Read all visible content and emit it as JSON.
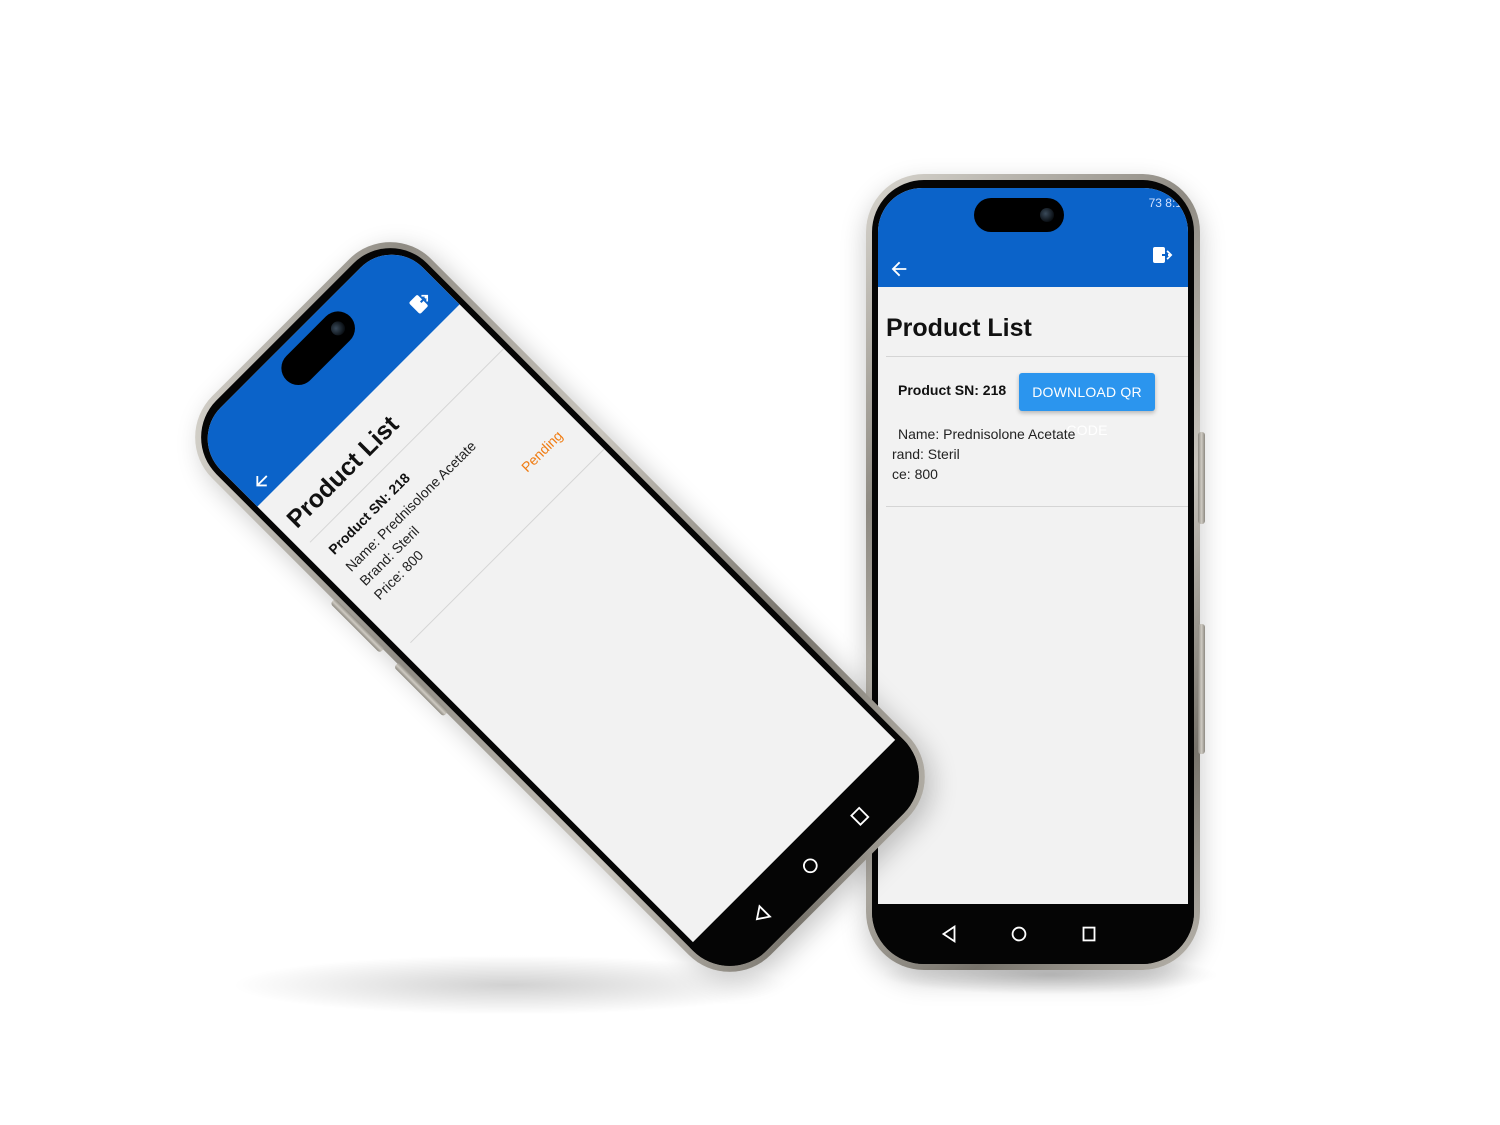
{
  "colors": {
    "appbar": "#0b63c9",
    "button": "#2b95ee",
    "pending": "#f07c12",
    "screen_bg": "#f2f2f2"
  },
  "left_phone": {
    "status_bar": "",
    "appbar": {
      "back_icon": "arrow-back-icon",
      "action_icon": "download-icon"
    },
    "page_title": "Product List",
    "product": {
      "sn": "Product SN: 218",
      "name": "Name: Prednisolone Acetate",
      "brand": "Brand: Steril",
      "price": "Price: 800",
      "status": "Pending"
    },
    "nav": [
      "back-triangle-icon",
      "home-circle-icon",
      "recents-square-icon"
    ]
  },
  "right_phone": {
    "status_bar": "73 8:1",
    "appbar": {
      "back_icon": "arrow-back-icon",
      "action_icon": "logout-icon"
    },
    "page_title": "Product List",
    "product": {
      "sn": "Product SN: 218",
      "download_button": "DOWNLOAD QR CODE",
      "name": "Name: Prednisolone Acetate",
      "brand": "rand: Steril",
      "price": "ce: 800"
    },
    "nav": [
      "back-triangle-icon",
      "home-circle-icon",
      "recents-square-icon"
    ]
  }
}
